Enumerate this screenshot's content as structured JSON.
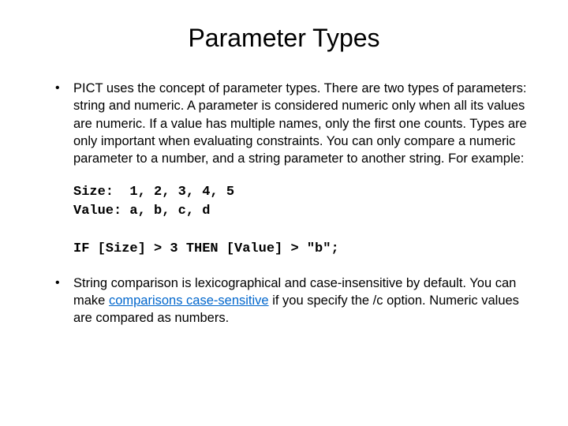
{
  "title": "Parameter Types",
  "bullets": [
    "PICT uses the concept of parameter types. There are two types of parameters: string and numeric. A parameter is considered numeric only when all its values are numeric. If a value has multiple names, only the first one counts. Types are only important when evaluating constraints. You can only compare a numeric parameter to a number, and a string parameter to another string. For example:"
  ],
  "code": {
    "line1": "Size:  1, 2, 3, 4, 5",
    "line2": "Value: a, b, c, d",
    "line3": "IF [Size] > 3 THEN [Value] > \"b\";"
  },
  "bullet2": {
    "before": "String comparison is lexicographical and case-insensitive by default. You can make ",
    "link": "comparisons case-sensitive",
    "after": " if you specify the /c option. Numeric values are compared as numbers."
  }
}
